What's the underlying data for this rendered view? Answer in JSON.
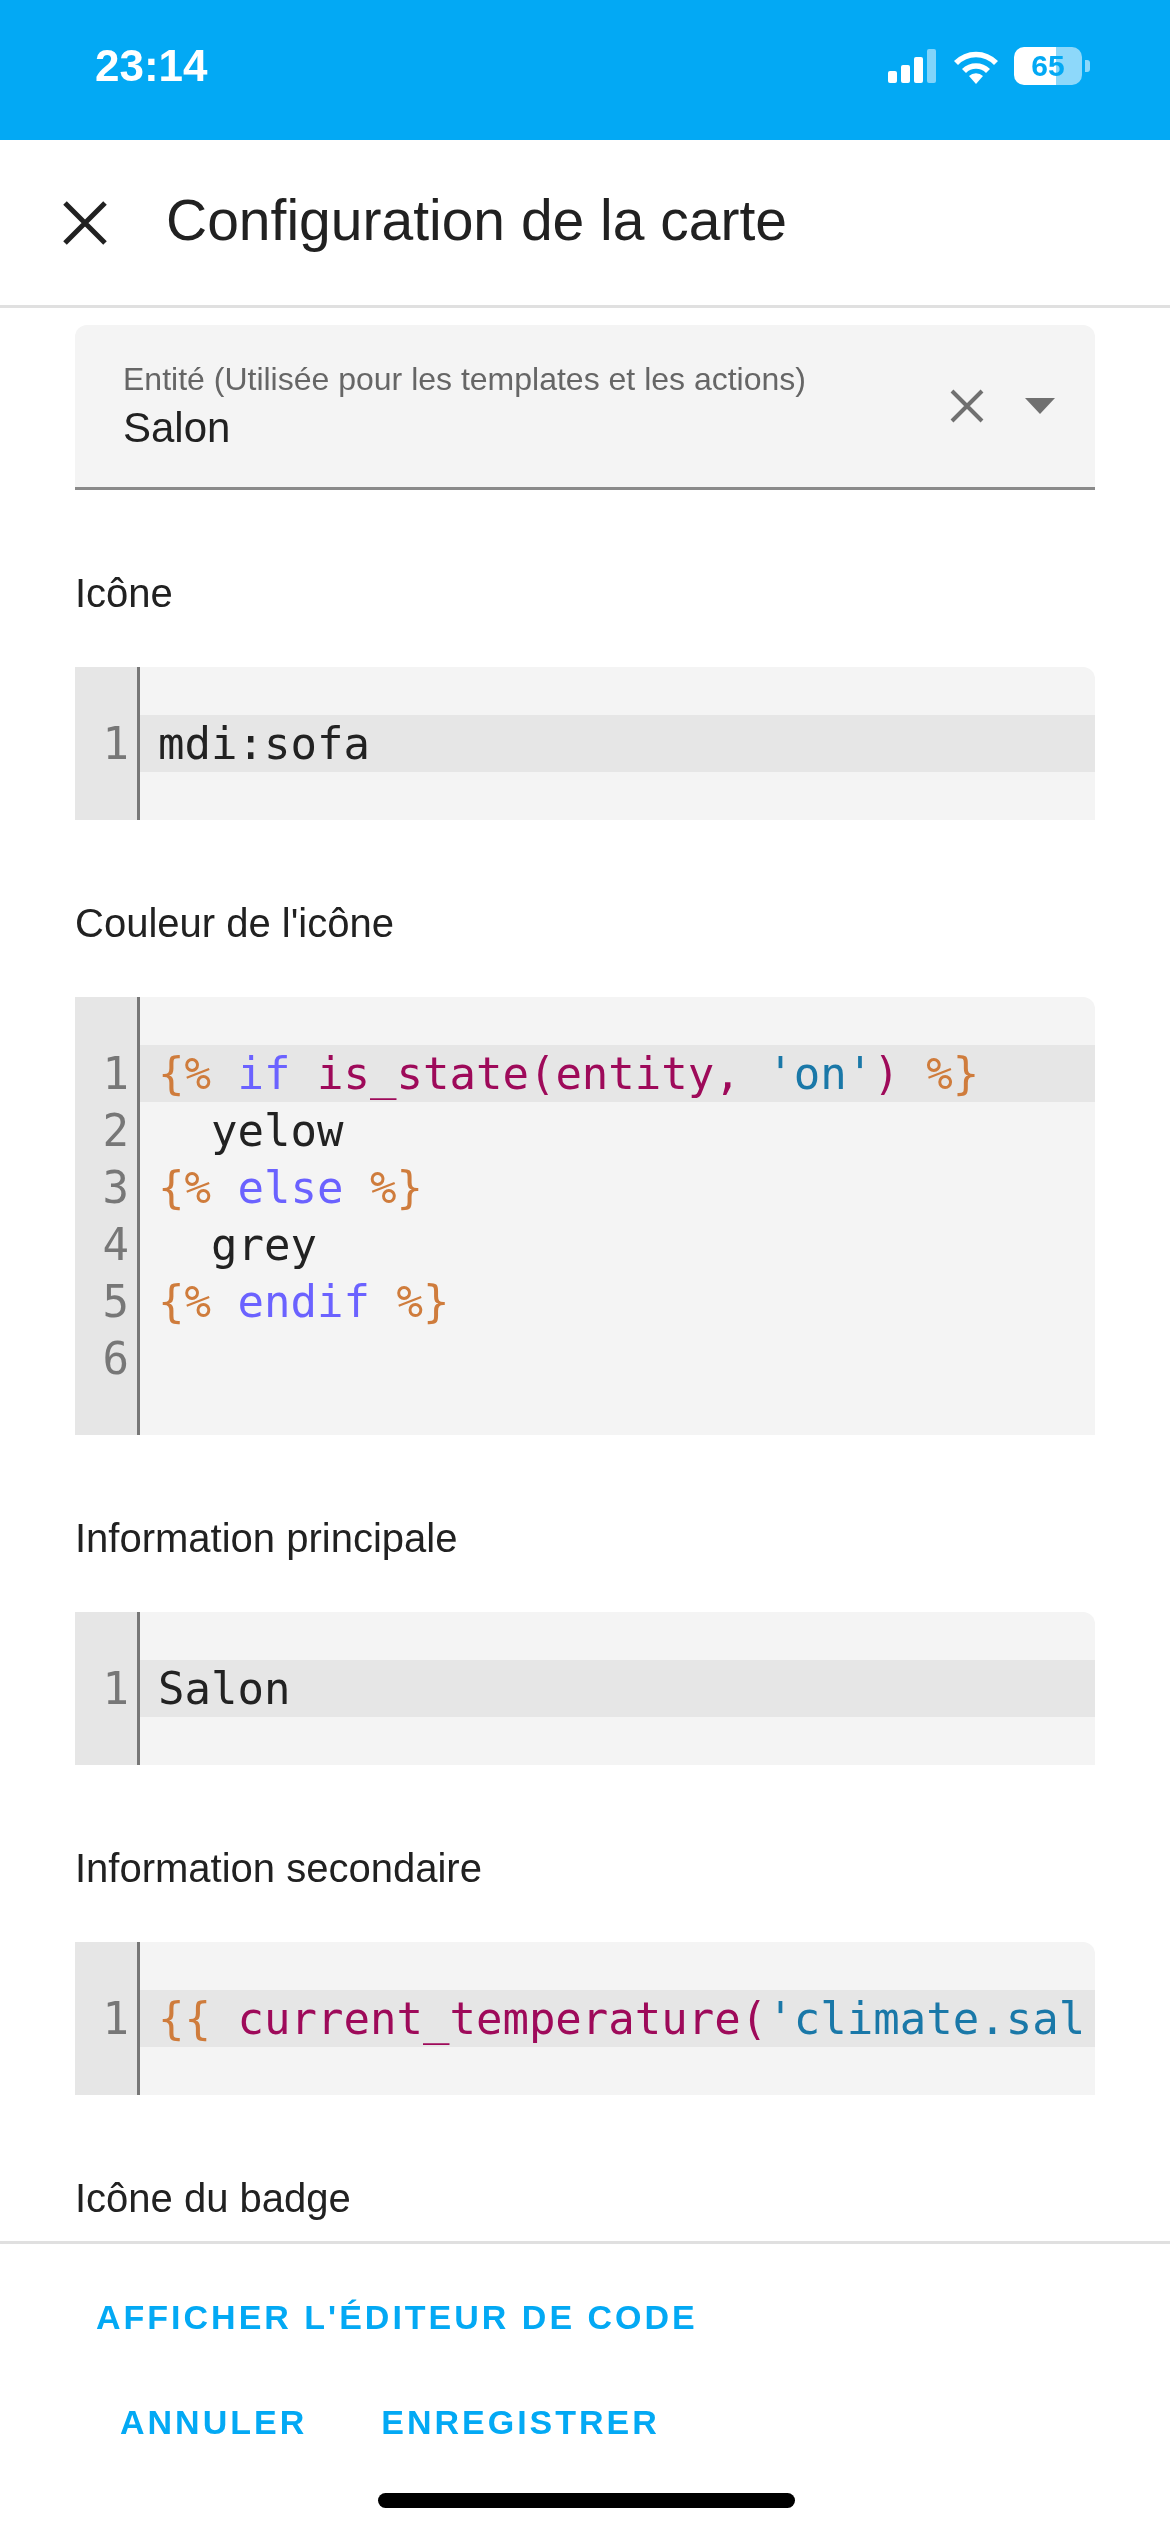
{
  "status_bar": {
    "time": "23:14",
    "battery": "65"
  },
  "header": {
    "title": "Configuration de la carte"
  },
  "entity_field": {
    "label": "Entité (Utilisée pour les templates et les actions)",
    "value": "Salon"
  },
  "sections": [
    {
      "label": "Icône",
      "code": [
        {
          "number": "1",
          "active": true,
          "tokens": [
            {
              "kind": "plain",
              "text": "mdi:sofa"
            }
          ]
        }
      ]
    },
    {
      "label": "Couleur de l'icône",
      "code": [
        {
          "number": "1",
          "active": true,
          "tokens": [
            {
              "kind": "delim",
              "text": "{% "
            },
            {
              "kind": "keyword",
              "text": "if "
            },
            {
              "kind": "func",
              "text": "is_state(entity, "
            },
            {
              "kind": "string",
              "text": "'on'"
            },
            {
              "kind": "func",
              "text": ") "
            },
            {
              "kind": "delim",
              "text": "%}"
            }
          ]
        },
        {
          "number": "2",
          "active": false,
          "tokens": [
            {
              "kind": "plain",
              "text": "  yelow"
            }
          ]
        },
        {
          "number": "3",
          "active": false,
          "tokens": [
            {
              "kind": "delim",
              "text": "{% "
            },
            {
              "kind": "keyword",
              "text": "else "
            },
            {
              "kind": "delim",
              "text": "%}"
            }
          ]
        },
        {
          "number": "4",
          "active": false,
          "tokens": [
            {
              "kind": "plain",
              "text": "  grey"
            }
          ]
        },
        {
          "number": "5",
          "active": false,
          "tokens": [
            {
              "kind": "delim",
              "text": "{% "
            },
            {
              "kind": "keyword",
              "text": "endif "
            },
            {
              "kind": "delim",
              "text": "%}"
            }
          ]
        },
        {
          "number": "6",
          "active": false
        }
      ]
    },
    {
      "label": "Information principale",
      "code": [
        {
          "number": "1",
          "active": true,
          "tokens": [
            {
              "kind": "plain",
              "text": "Salon"
            }
          ]
        }
      ]
    },
    {
      "label": "Information secondaire",
      "code": [
        {
          "number": "1",
          "active": true,
          "tokens": [
            {
              "kind": "delim",
              "text": "{{ "
            },
            {
              "kind": "func",
              "text": "current_temperature("
            },
            {
              "kind": "string",
              "text": "'climate.sal"
            }
          ]
        }
      ]
    },
    {
      "label": "Icône du badge"
    }
  ],
  "footer": {
    "editor_link": "AFFICHER L'ÉDITEUR DE CODE",
    "buttons": [
      "ANNULER",
      "ENREGISTRER"
    ]
  }
}
